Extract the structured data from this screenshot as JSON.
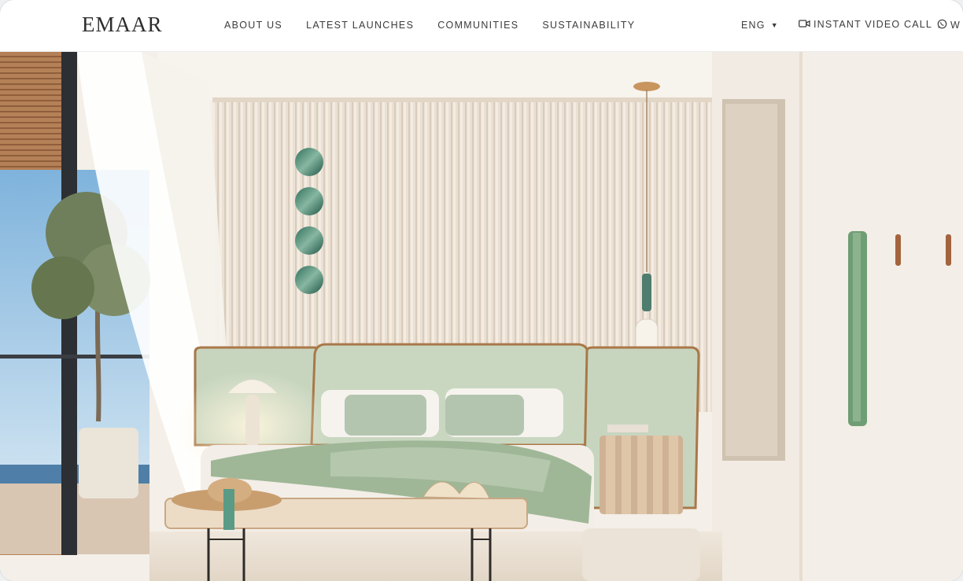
{
  "header": {
    "logo": "EMAAR",
    "nav": [
      "ABOUT US",
      "LATEST LAUNCHES",
      "COMMUNITIES",
      "SUSTAINABILITY"
    ],
    "language": "ENG",
    "video_call": "INSTANT VIDEO CALL",
    "whatsapp": "W"
  },
  "icons": {
    "language_caret": "caret-down-icon",
    "video_call": "video-camera-icon",
    "whatsapp": "whatsapp-icon"
  },
  "colors": {
    "text": "#3c3c3c",
    "logo": "#2d2d2d",
    "sage_green": "#b9cdb4",
    "wall_cream": "#e9dfd1",
    "wood": "#b98558"
  }
}
